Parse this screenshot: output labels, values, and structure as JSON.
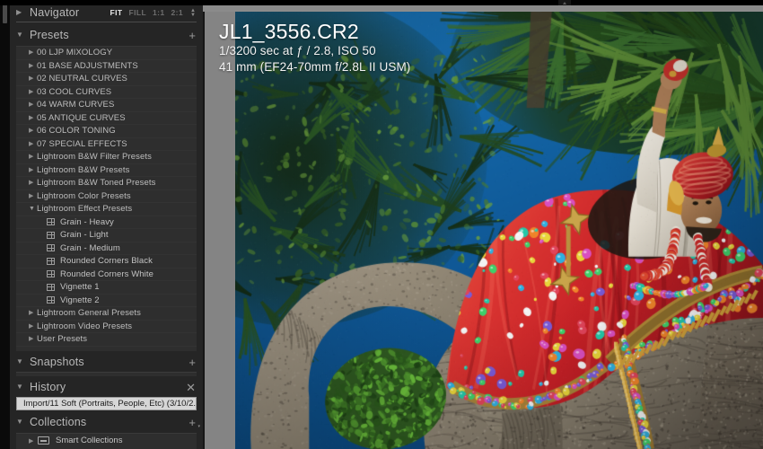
{
  "navigator": {
    "title": "Navigator",
    "collapse_icon": "triangle-right-icon",
    "zoom_levels": [
      {
        "label": "FIT",
        "active": true
      },
      {
        "label": "FILL",
        "active": false
      },
      {
        "label": "1:1",
        "active": false
      },
      {
        "label": "2:1",
        "active": false
      }
    ],
    "stepper_icon": "chevron-updown-icon"
  },
  "presets": {
    "title": "Presets",
    "add_label": "+",
    "collapse_icon": "triangle-down-icon",
    "items": [
      {
        "label": "00 LJP MIXOLOGY",
        "type": "folder",
        "expanded": false
      },
      {
        "label": "01 BASE ADJUSTMENTS",
        "type": "folder",
        "expanded": false
      },
      {
        "label": "02 NEUTRAL CURVES",
        "type": "folder",
        "expanded": false
      },
      {
        "label": "03 COOL CURVES",
        "type": "folder",
        "expanded": false
      },
      {
        "label": "04 WARM CURVES",
        "type": "folder",
        "expanded": false
      },
      {
        "label": "05 ANTIQUE CURVES",
        "type": "folder",
        "expanded": false
      },
      {
        "label": "06 COLOR TONING",
        "type": "folder",
        "expanded": false
      },
      {
        "label": "07 SPECIAL EFFECTS",
        "type": "folder",
        "expanded": false
      },
      {
        "label": "Lightroom B&W Filter Presets",
        "type": "folder",
        "expanded": false
      },
      {
        "label": "Lightroom B&W Presets",
        "type": "folder",
        "expanded": false
      },
      {
        "label": "Lightroom B&W Toned Presets",
        "type": "folder",
        "expanded": false
      },
      {
        "label": "Lightroom Color Presets",
        "type": "folder",
        "expanded": false
      },
      {
        "label": "Lightroom Effect Presets",
        "type": "folder",
        "expanded": true
      },
      {
        "label": "Grain - Heavy",
        "type": "preset"
      },
      {
        "label": "Grain - Light",
        "type": "preset"
      },
      {
        "label": "Grain - Medium",
        "type": "preset"
      },
      {
        "label": "Rounded Corners Black",
        "type": "preset"
      },
      {
        "label": "Rounded Corners White",
        "type": "preset"
      },
      {
        "label": "Vignette 1",
        "type": "preset"
      },
      {
        "label": "Vignette 2",
        "type": "preset"
      },
      {
        "label": "Lightroom General Presets",
        "type": "folder",
        "expanded": false
      },
      {
        "label": "Lightroom Video Presets",
        "type": "folder",
        "expanded": false
      },
      {
        "label": "User Presets",
        "type": "folder",
        "expanded": false
      }
    ]
  },
  "snapshots": {
    "title": "Snapshots",
    "add_label": "+",
    "collapse_icon": "triangle-down-icon"
  },
  "history": {
    "title": "History",
    "clear_label": "✕",
    "collapse_icon": "triangle-down-icon",
    "entries": [
      {
        "label": "Import/11 Soft (Portraits, People, Etc) (3/10/2...",
        "selected": true
      }
    ]
  },
  "collections": {
    "title": "Collections",
    "add_label": "+",
    "collapse_icon": "triangle-down-icon",
    "items": [
      {
        "label": "Smart Collections",
        "icon": "collection-box-icon",
        "expanded": false
      }
    ]
  },
  "photo_info": {
    "filename": "JL1_3556.CR2",
    "exposure_line": "1/3200 sec at ƒ / 2.8, ISO 50",
    "lens_line": "41 mm (EF24-70mm f/2.8L II USM)"
  },
  "photo": {
    "description": "Decorated elephant with red jeweled caparison carrying a groom in white sherwani and red turban, palm trees against blue sky",
    "colors": {
      "sky": "#1669ad",
      "sky_deep": "#0d4f8c",
      "caparison_red": "#c8282c",
      "caparison_red_light": "#e04a3e",
      "gold_trim": "#b8913f",
      "elephant_gray": "#8e8578",
      "elephant_gray_dark": "#6b6357",
      "foliage_dark": "#1e3a20",
      "foliage_mid": "#3d6b2e",
      "foliage_light": "#6f9a3a",
      "sherwani_white": "#ece7de",
      "turban_red": "#b8262a",
      "skin": "#a9784f"
    }
  },
  "chrome": {
    "panel_bg": "#252525",
    "divider_gray": "#848484",
    "accent_selected": "#d6d6d6"
  }
}
